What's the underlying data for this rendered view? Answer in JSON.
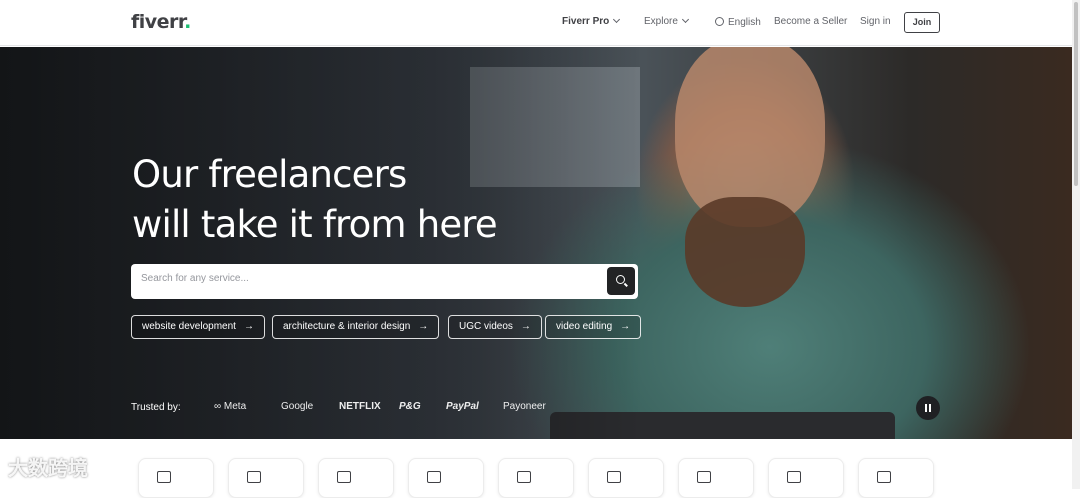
{
  "header": {
    "logo": "fiverr",
    "logo_dot": ".",
    "nav": {
      "fiverr_pro": "Fiverr Pro",
      "explore": "Explore",
      "language": "English",
      "become_seller": "Become a Seller",
      "sign_in": "Sign in",
      "join": "Join"
    }
  },
  "hero": {
    "headline_line1": "Our freelancers",
    "headline_line2": "will take it from here",
    "search": {
      "placeholder": "Search for any service..."
    },
    "chips": [
      {
        "label": "website development",
        "arrow": "→"
      },
      {
        "label": "architecture & interior design",
        "arrow": "→"
      },
      {
        "label": "UGC videos",
        "arrow": "→"
      },
      {
        "label": "video editing",
        "arrow": "→"
      }
    ],
    "trusted_by": "Trusted by:",
    "brands": [
      "∞ Meta",
      "Google",
      "NETFLIX",
      "P&G",
      "PayPal",
      "Payoneer"
    ]
  },
  "categories": {
    "icons": [
      "programming-tech-icon",
      "graphics-design-icon",
      "digital-marketing-icon",
      "writing-translation-icon",
      "video-animation-icon",
      "ai-services-icon",
      "music-audio-icon",
      "business-icon",
      "consulting-icon"
    ]
  },
  "watermark": "大数跨境",
  "colors": {
    "brand_green": "#1dbf73",
    "text_dark": "#404145",
    "search_button": "#222325"
  }
}
